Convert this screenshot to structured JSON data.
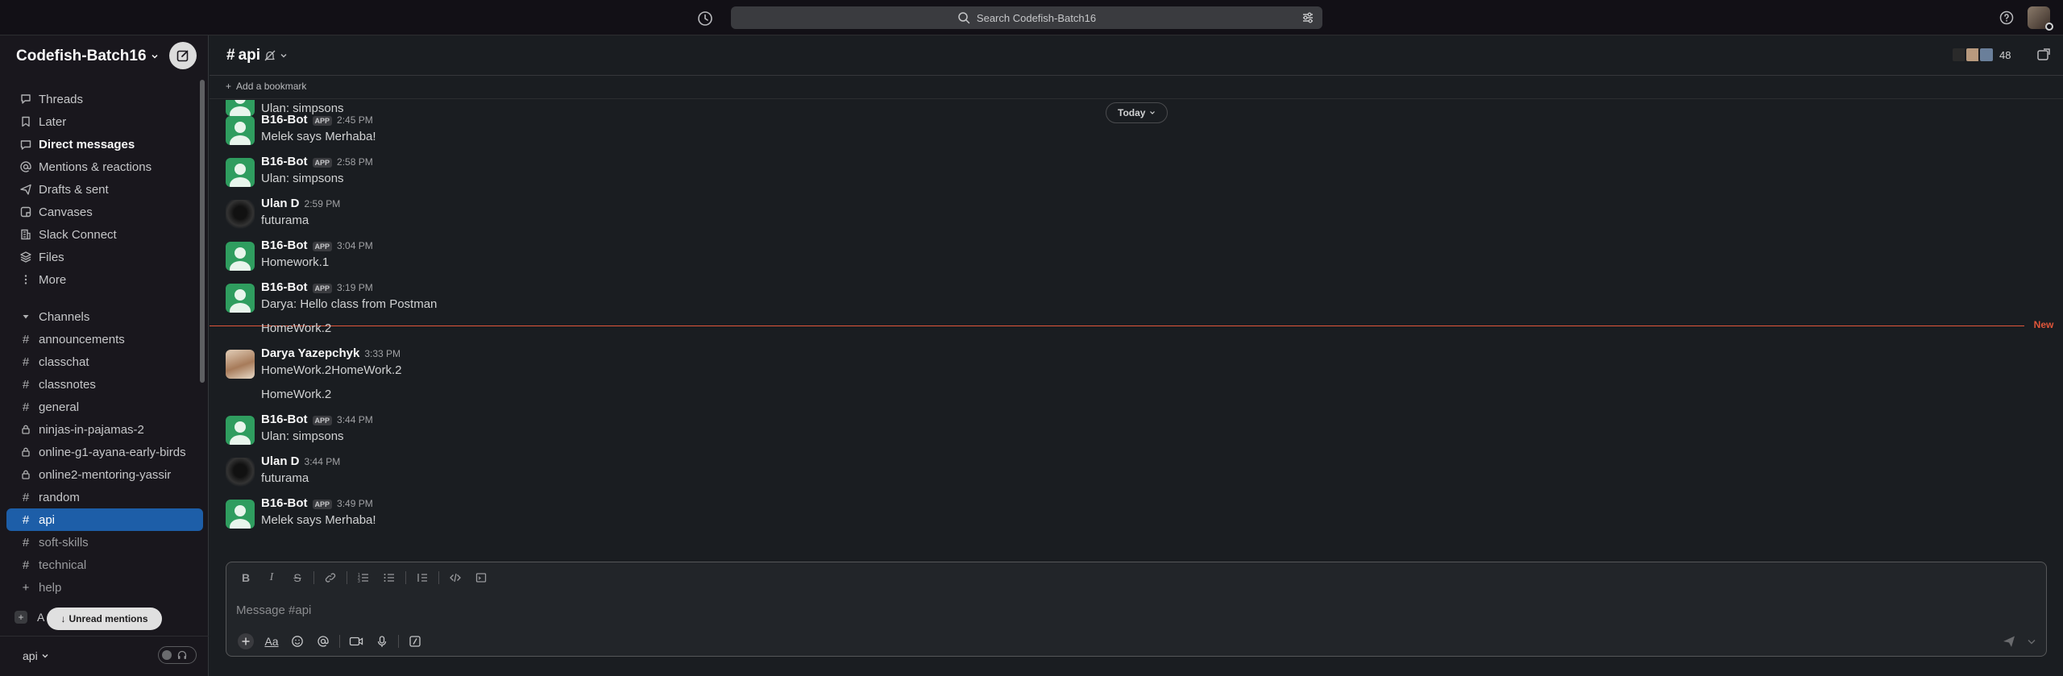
{
  "search": {
    "placeholder": "Search Codefish-Batch16"
  },
  "workspace": {
    "name": "Codefish-Batch16"
  },
  "nav": [
    {
      "label": "Threads",
      "icon": "threads-icon",
      "bold": false
    },
    {
      "label": "Later",
      "icon": "bookmark-icon",
      "bold": false
    },
    {
      "label": "Direct messages",
      "icon": "dm-icon",
      "bold": true
    },
    {
      "label": "Mentions & reactions",
      "icon": "at-icon",
      "bold": false
    },
    {
      "label": "Drafts & sent",
      "icon": "send-icon",
      "bold": false
    },
    {
      "label": "Canvases",
      "icon": "canvas-icon",
      "bold": false
    },
    {
      "label": "Slack Connect",
      "icon": "building-icon",
      "bold": false
    },
    {
      "label": "Files",
      "icon": "files-icon",
      "bold": false
    },
    {
      "label": "More",
      "icon": "more-icon",
      "bold": false
    }
  ],
  "channels_section": {
    "label": "Channels"
  },
  "channels": [
    {
      "name": "announcements",
      "locked": false
    },
    {
      "name": "classchat",
      "locked": false
    },
    {
      "name": "classnotes",
      "locked": false
    },
    {
      "name": "general",
      "locked": false
    },
    {
      "name": "ninjas-in-pajamas-2",
      "locked": true
    },
    {
      "name": "online-g1-ayana-early-birds",
      "locked": true
    },
    {
      "name": "online2-mentoring-yassir",
      "locked": true
    },
    {
      "name": "random",
      "locked": false
    },
    {
      "name": "api",
      "locked": false,
      "active": true
    },
    {
      "name": "soft-skills",
      "locked": false,
      "muted": true
    },
    {
      "name": "technical",
      "locked": false,
      "muted": true
    },
    {
      "name": "help",
      "locked": false,
      "muted": true
    }
  ],
  "add_channels_partial": "A",
  "unread_mentions": "Unread mentions",
  "huddle": {
    "channel": "api"
  },
  "channel": {
    "name": "api",
    "member_count": "48",
    "bookmark": "Add a bookmark"
  },
  "date_divider": "Today",
  "new_label": "New",
  "messages": [
    {
      "user": "",
      "app": false,
      "time": "",
      "text": "Ulan: simpsons",
      "avatar": "bot",
      "partial": true
    },
    {
      "user": "B16-Bot",
      "app": true,
      "time": "2:45 PM",
      "text": "Melek says Merhaba!",
      "avatar": "bot"
    },
    {
      "user": "B16-Bot",
      "app": true,
      "time": "2:58 PM",
      "text": "Ulan: simpsons",
      "avatar": "bot"
    },
    {
      "user": "Ulan D",
      "app": false,
      "time": "2:59 PM",
      "text": "futurama",
      "avatar": "ulan"
    },
    {
      "user": "B16-Bot",
      "app": true,
      "time": "3:04 PM",
      "text": "Homework.1",
      "avatar": "bot"
    },
    {
      "user": "B16-Bot",
      "app": true,
      "time": "3:19 PM",
      "text": "Darya: Hello class from Postman",
      "text2": "HomeWork.2",
      "avatar": "bot"
    },
    {
      "user": "Darya Yazepchyk",
      "app": false,
      "time": "3:33 PM",
      "text": "HomeWork.2HomeWork.2",
      "text2": "HomeWork.2",
      "avatar": "darya"
    },
    {
      "user": "B16-Bot",
      "app": true,
      "time": "3:44 PM",
      "text": "Ulan: simpsons",
      "avatar": "bot"
    },
    {
      "user": "Ulan D",
      "app": false,
      "time": "3:44 PM",
      "text": "futurama",
      "avatar": "ulan"
    },
    {
      "user": "B16-Bot",
      "app": true,
      "time": "3:49 PM",
      "text": "Melek says Merhaba!",
      "avatar": "bot"
    }
  ],
  "app_tag": "APP",
  "composer": {
    "placeholder": "Message #api"
  },
  "colors": {
    "active": "#1d5ea8",
    "new_line": "#e0563a",
    "bot_avatar": "#2f9d5f"
  }
}
